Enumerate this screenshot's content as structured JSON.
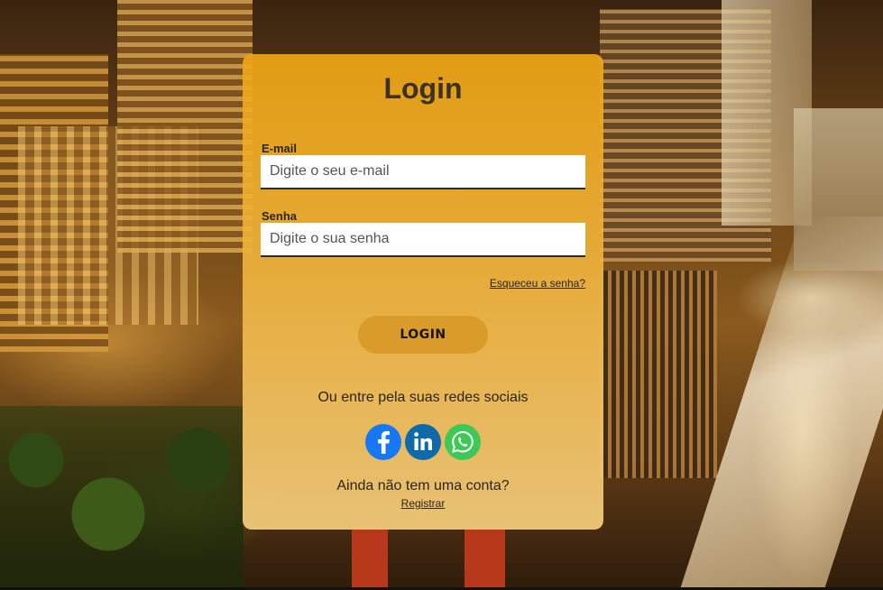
{
  "login_card": {
    "title": "Login",
    "email": {
      "label": "E-mail",
      "value": "",
      "placeholder": "Digite o seu e-mail"
    },
    "password": {
      "label": "Senha",
      "value": "",
      "placeholder": "Digite o sua senha"
    },
    "forgot_password_link": "Esqueceu a senha?",
    "login_button": "LOGIN",
    "social_prompt": "Ou entre pela suas redes sociais",
    "social_icons": [
      "facebook-icon",
      "linkedin-icon",
      "whatsapp-icon"
    ],
    "no_account_text": "Ainda não tem uma conta?",
    "register_link": "Registrar"
  },
  "colors": {
    "card_top": "#eea514",
    "card_bottom": "#f4cd7d",
    "login_button": "#d99b2a",
    "facebook": "#1877f2",
    "linkedin": "#0e6aa8",
    "whatsapp": "#3ec957"
  }
}
